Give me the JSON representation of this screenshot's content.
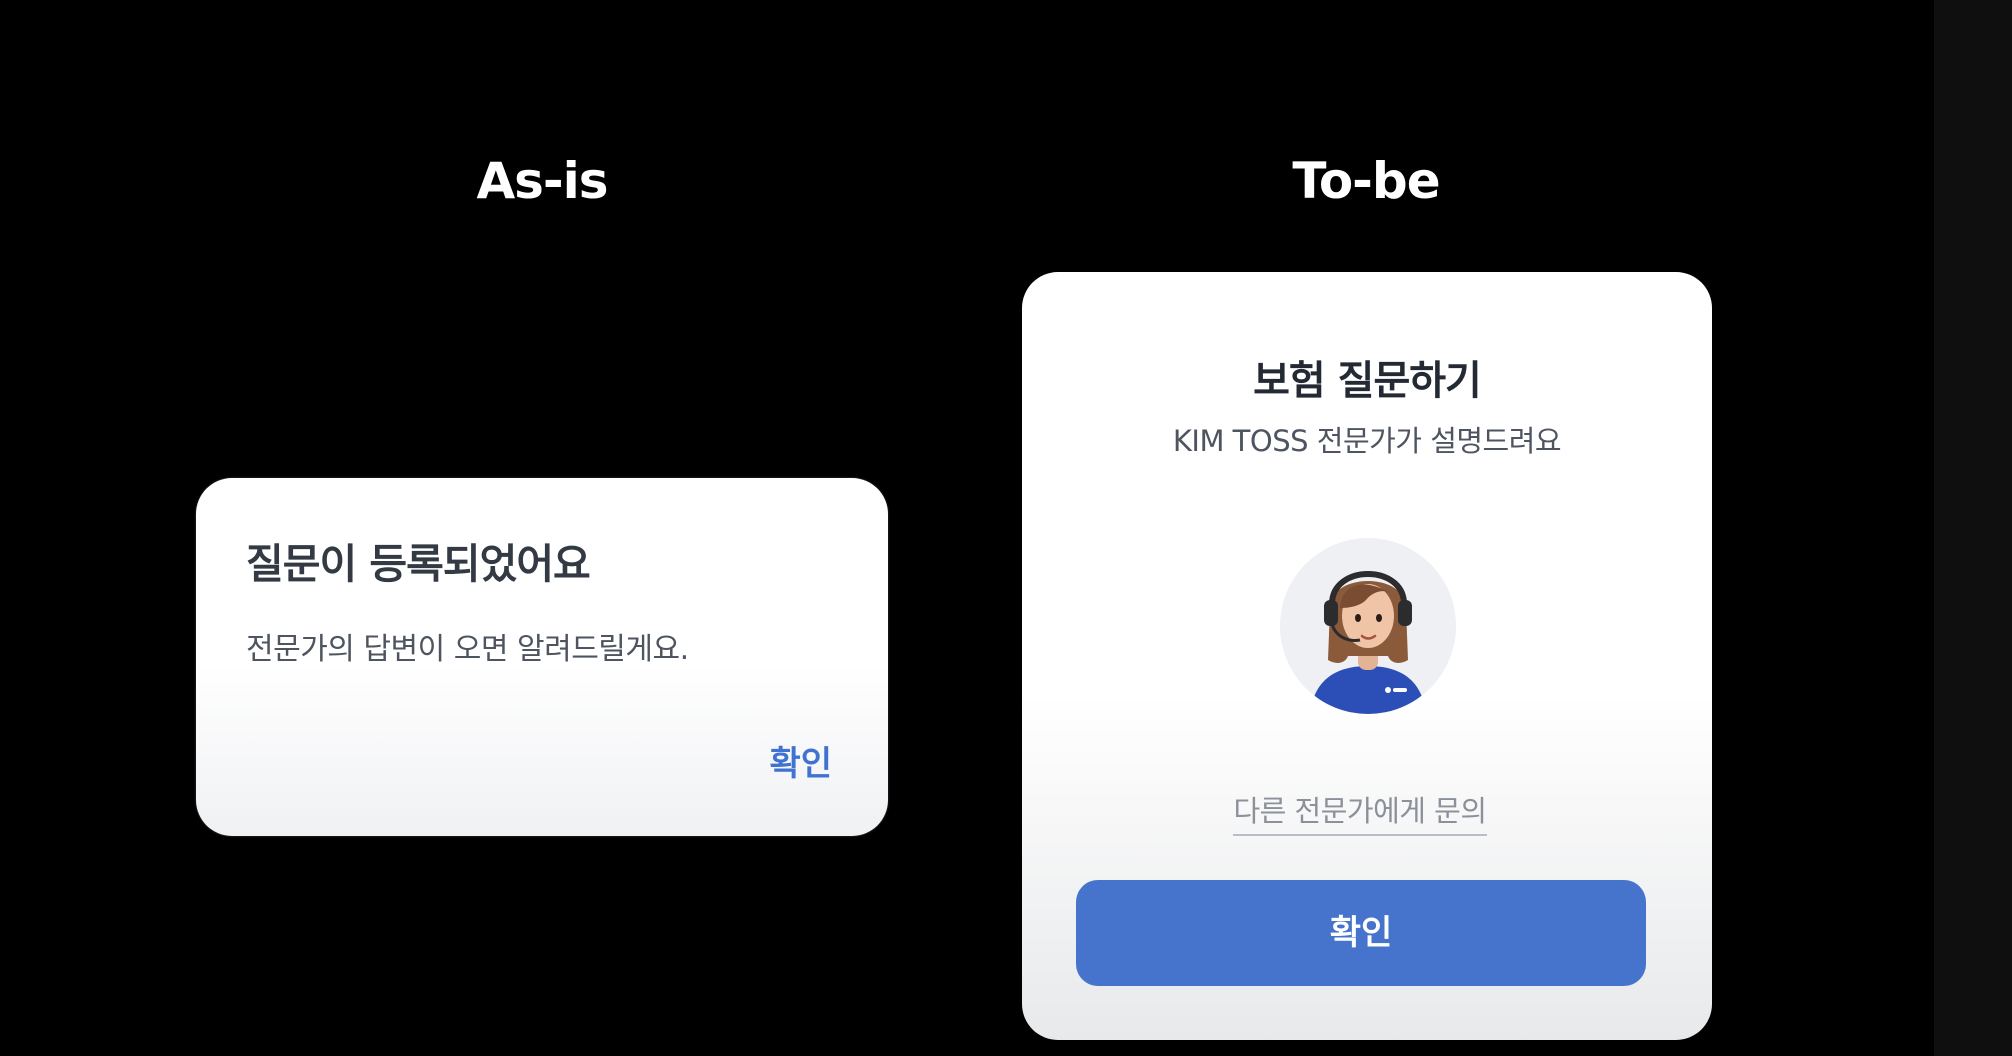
{
  "headings": {
    "as_is": "As-is",
    "to_be": "To-be"
  },
  "as_is_dialog": {
    "title": "질문이 등록되었어요",
    "body": "전문가의 답변이 오면 알려드릴게요.",
    "confirm_label": "확인"
  },
  "to_be_dialog": {
    "title": "보험 질문하기",
    "subtitle": "KIM TOSS 전문가가 설명드려요",
    "avatar_icon": "expert-avatar-icon",
    "other_expert_link": "다른 전문가에게 문의",
    "confirm_label": "확인"
  },
  "colors": {
    "background": "#000000",
    "accent_blue": "#4674cc",
    "text_button_blue": "#3f72d1"
  }
}
